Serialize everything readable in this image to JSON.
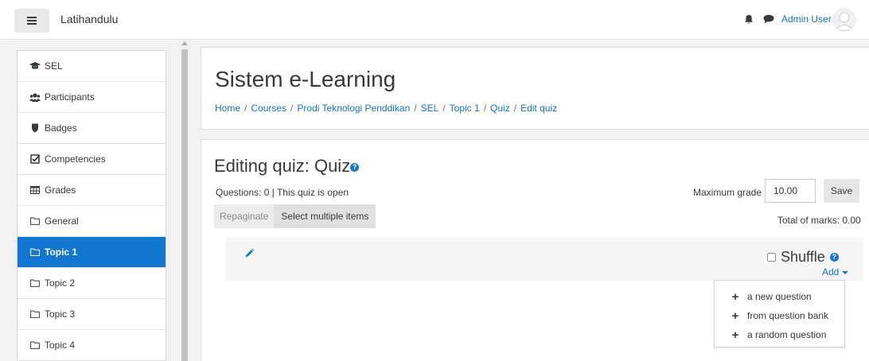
{
  "navbar": {
    "brand": "Latihandulu",
    "user_name": "Admin User",
    "icons": [
      "menu-icon",
      "bell-icon",
      "chat-icon",
      "avatar"
    ]
  },
  "sidebar": {
    "items": [
      {
        "label": "SEL",
        "icon": "graduation-cap-icon"
      },
      {
        "label": "Participants",
        "icon": "users-icon"
      },
      {
        "label": "Badges",
        "icon": "badge-shield-icon"
      },
      {
        "label": "Competencies",
        "icon": "checkbox-icon"
      },
      {
        "label": "Grades",
        "icon": "grid-icon"
      },
      {
        "label": "General",
        "icon": "folder-icon"
      },
      {
        "label": "Topic 1",
        "icon": "folder-icon",
        "active": true
      },
      {
        "label": "Topic 2",
        "icon": "folder-icon"
      },
      {
        "label": "Topic 3",
        "icon": "folder-icon"
      },
      {
        "label": "Topic 4",
        "icon": "folder-icon"
      }
    ]
  },
  "header": {
    "title": "Sistem e-Learning",
    "breadcrumb": [
      "Home",
      "Courses",
      "Prodi Teknologi Penddikan",
      "SEL",
      "Topic 1",
      "Quiz",
      "Edit quiz"
    ]
  },
  "quiz": {
    "title": "Editing quiz: Quiz",
    "info": "Questions: 0 | This quiz is open",
    "repaginate_label": "Repaginate",
    "select_multiple_label": "Select multiple items",
    "max_grade_label": "Maximum grade",
    "max_grade_value": "10.00",
    "save_label": "Save",
    "total_marks": "Total of marks: 0.00",
    "shuffle_label": "Shuffle",
    "add_label": "Add"
  },
  "add_menu": {
    "items": [
      "a new question",
      "from question bank",
      "a random question"
    ]
  },
  "colors": {
    "accent": "#1177d1",
    "page_bg": "#f2f2f2"
  }
}
